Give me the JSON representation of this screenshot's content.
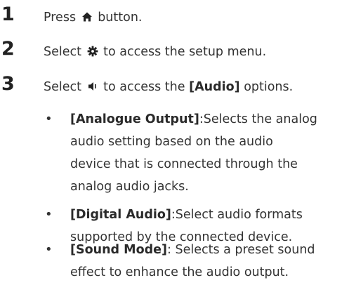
{
  "steps": [
    {
      "num": "1",
      "pre": "Press ",
      "icon": "home-icon",
      "post": " button."
    },
    {
      "num": "2",
      "pre": "Select ",
      "icon": "gear-icon",
      "post": " to access the setup menu."
    },
    {
      "num": "3",
      "pre": "Select ",
      "icon": "speaker-icon",
      "post": " to access the ",
      "bold": "[Audio]",
      "post2": " options."
    }
  ],
  "bullets": [
    {
      "title": "[Analogue Output]",
      "lines": [
        ":Selects the analog",
        "audio setting based on the audio",
        "device that is connected through the",
        "analog audio jacks."
      ]
    },
    {
      "title": "[Digital Audio]",
      "lines": [
        ":Select audio formats",
        "supported by the connected device."
      ]
    },
    {
      "title": "[Sound Mode]",
      "lines": [
        ": Selects a preset sound",
        "effect to enhance the audio output."
      ]
    }
  ],
  "bullet_symbol": "•",
  "colors": {
    "text": "#333333",
    "heading": "#222222"
  }
}
